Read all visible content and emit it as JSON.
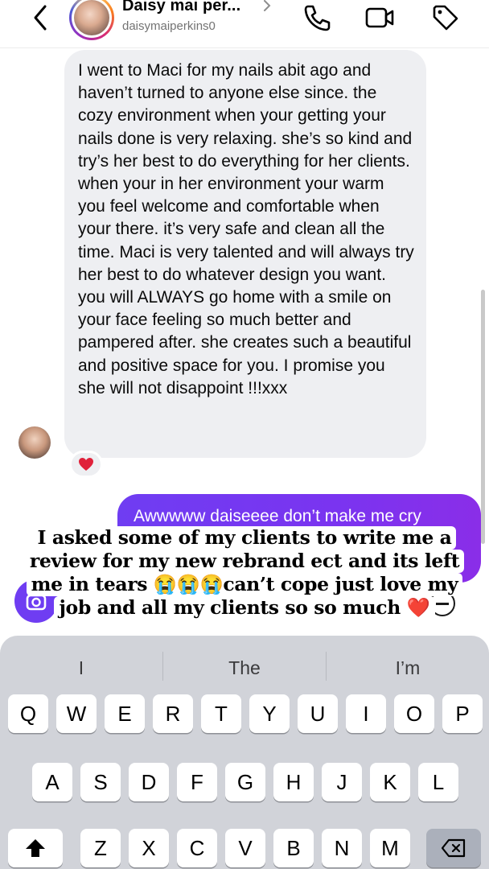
{
  "header": {
    "name": "Daisy mai per...",
    "username": "daisymaiperkins0",
    "icons": [
      "back-chevron-icon",
      "phone-icon",
      "video-camera-icon",
      "tag-icon"
    ]
  },
  "messages": [
    {
      "direction": "incoming",
      "text": "I went to Maci for my nails abit ago and haven’t turned to anyone else since. the cozy environment when your getting your nails done is very relaxing. she’s so kind and try’s her best to do everything for her clients. when your in her environment your warm you feel welcome and comfortable when your there. it’s very safe and clean all the time. Maci is very talented and will always try her best to do whatever design you want. you will ALWAYS go home with a smile on your face feeling so much better and pampered after. she creates such a beautiful and positive space for you. I promise you she will not disappoint !!!xxx",
      "reaction": "❤️"
    },
    {
      "direction": "outgoing",
      "text": "Awwwww daiseeee don’t make me cry"
    }
  ],
  "caption": {
    "lines": [
      "I asked some of my clients to write me a",
      "review for my new rebrand ect and its left",
      "me in tears 😭😭😭can’t cope just love my",
      "job and all my clients so so much ❤️"
    ]
  },
  "keyboard": {
    "suggestions": [
      "I",
      "The",
      "I’m"
    ],
    "row1": [
      "Q",
      "W",
      "E",
      "R",
      "T",
      "Y",
      "U",
      "I",
      "O",
      "P"
    ],
    "row2": [
      "A",
      "S",
      "D",
      "F",
      "G",
      "H",
      "J",
      "K",
      "L"
    ],
    "row3": [
      "Z",
      "X",
      "C",
      "V",
      "B",
      "N",
      "M"
    ]
  },
  "colors": {
    "accent": "#6f3df2",
    "incoming_bubble": "#eeeff2",
    "keyboard_bg": "#d1d3d9",
    "reaction_heart": "#e0213a"
  }
}
